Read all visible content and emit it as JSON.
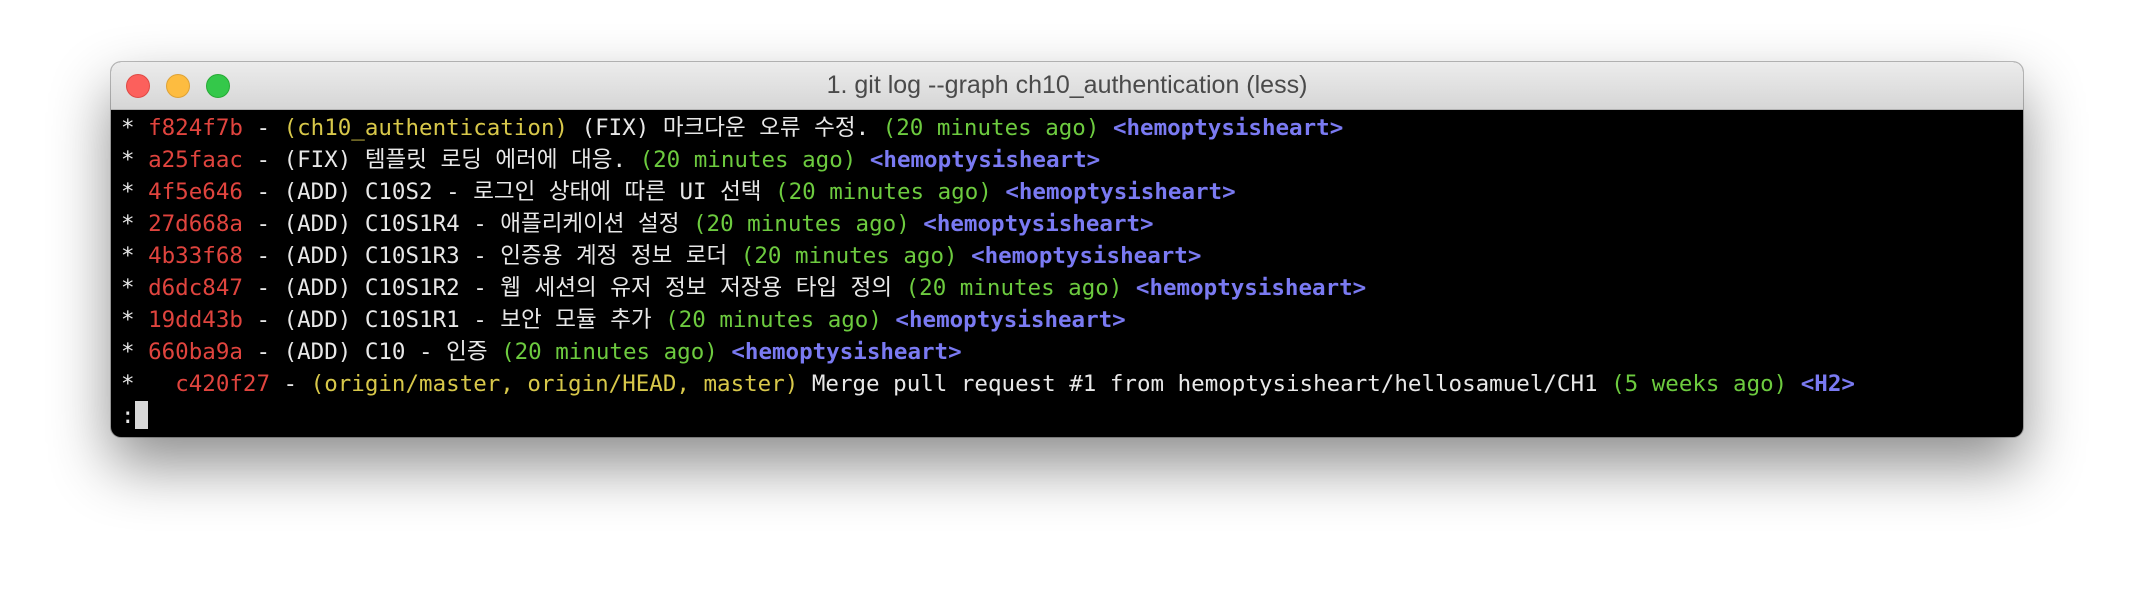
{
  "window": {
    "title": "1. git log --graph  ch10_authentication (less)"
  },
  "colors": {
    "hash": "#e0443e",
    "refs": "#d8c84a",
    "time": "#6dcb3f",
    "author": "#7a7af2",
    "text": "#e8e8e8",
    "background": "#000000"
  },
  "log": [
    {
      "graph": "* ",
      "hash": "f824f7b",
      "sep": " - ",
      "refs": "(ch10_authentication)",
      "message": " (FIX) 마크다운 오류 수정. ",
      "time": "(20 minutes ago)",
      "author": " <hemoptysisheart>"
    },
    {
      "graph": "* ",
      "hash": "a25faac",
      "sep": " - ",
      "refs": "",
      "message": "(FIX) 템플릿 로딩 에러에 대응. ",
      "time": "(20 minutes ago)",
      "author": " <hemoptysisheart>"
    },
    {
      "graph": "* ",
      "hash": "4f5e646",
      "sep": " - ",
      "refs": "",
      "message": "(ADD) C10S2 - 로그인 상태에 따른 UI 선택 ",
      "time": "(20 minutes ago)",
      "author": " <hemoptysisheart>"
    },
    {
      "graph": "* ",
      "hash": "27d668a",
      "sep": " - ",
      "refs": "",
      "message": "(ADD) C10S1R4 - 애플리케이션 설정 ",
      "time": "(20 minutes ago)",
      "author": " <hemoptysisheart>"
    },
    {
      "graph": "* ",
      "hash": "4b33f68",
      "sep": " - ",
      "refs": "",
      "message": "(ADD) C10S1R3 - 인증용 계정 정보 로더 ",
      "time": "(20 minutes ago)",
      "author": " <hemoptysisheart>"
    },
    {
      "graph": "* ",
      "hash": "d6dc847",
      "sep": " - ",
      "refs": "",
      "message": "(ADD) C10S1R2 - 웹 세션의 유저 정보 저장용 타입 정의 ",
      "time": "(20 minutes ago)",
      "author": " <hemoptysisheart>"
    },
    {
      "graph": "* ",
      "hash": "19dd43b",
      "sep": " - ",
      "refs": "",
      "message": "(ADD) C10S1R1 - 보안 모듈 추가 ",
      "time": "(20 minutes ago)",
      "author": " <hemoptysisheart>"
    },
    {
      "graph": "* ",
      "hash": "660ba9a",
      "sep": " - ",
      "refs": "",
      "message": "(ADD) C10 - 인증 ",
      "time": "(20 minutes ago)",
      "author": " <hemoptysisheart>"
    },
    {
      "graph": "*   ",
      "hash": "c420f27",
      "sep": " - ",
      "refs": "(origin/master, origin/HEAD, master)",
      "message": " Merge pull request #1 from hemoptysisheart/hellosamuel/CH1 ",
      "time": "(5 weeks ago)",
      "author": " <H2>"
    }
  ],
  "prompt": ":"
}
